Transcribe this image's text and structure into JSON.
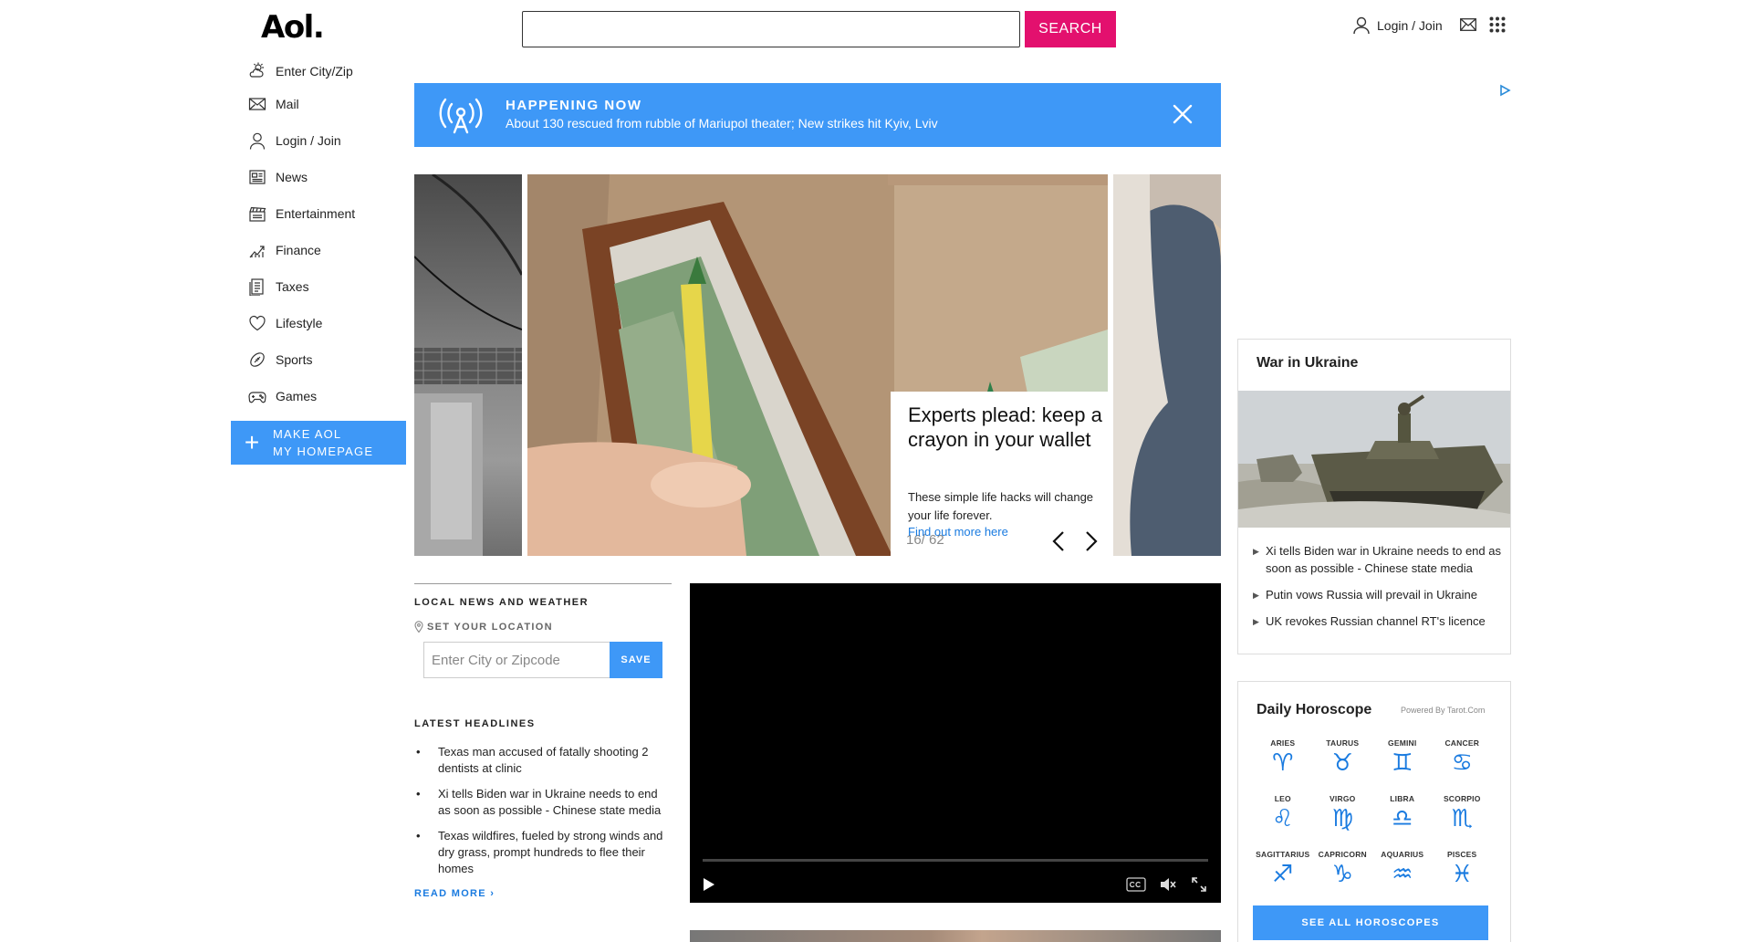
{
  "header": {
    "logo": "Aol.",
    "search_placeholder": "",
    "search_button": "SEARCH",
    "login_label": "Login / Join"
  },
  "nav": {
    "items": [
      {
        "label": "Enter City/Zip",
        "icon": "weather-icon"
      },
      {
        "label": "Mail",
        "icon": "mail-icon"
      },
      {
        "label": "Login / Join",
        "icon": "user-icon"
      },
      {
        "label": "News",
        "icon": "newspaper-icon"
      },
      {
        "label": "Entertainment",
        "icon": "clapperboard-icon"
      },
      {
        "label": "Finance",
        "icon": "chart-icon"
      },
      {
        "label": "Taxes",
        "icon": "document-icon"
      },
      {
        "label": "Lifestyle",
        "icon": "heart-icon"
      },
      {
        "label": "Sports",
        "icon": "football-icon"
      },
      {
        "label": "Games",
        "icon": "gamepad-icon"
      }
    ],
    "make_homepage_line1": "MAKE AOL",
    "make_homepage_line2": "MY HOMEPAGE"
  },
  "breaking": {
    "label": "HAPPENING NOW",
    "text": "About 130 rescued from rubble of Mariupol theater; New strikes hit Kyiv, Lviv"
  },
  "carousel": {
    "title": "Experts plead: keep a crayon in your wallet",
    "description": "These simple life hacks will change your life forever.",
    "link": "Find out more here",
    "counter": "16/ 62"
  },
  "local": {
    "title": "LOCAL NEWS AND WEATHER",
    "set_location": "SET YOUR LOCATION",
    "input_placeholder": "Enter City or Zipcode",
    "save": "SAVE",
    "latest_title": "LATEST HEADLINES",
    "headlines": [
      "Texas man accused of fatally shooting 2 dentists at clinic",
      "Xi tells Biden war in Ukraine needs to end as soon as possible - Chinese state media",
      "Texas wildfires, fueled by strong winds and dry grass, prompt hundreds to flee their homes"
    ],
    "read_more": "READ MORE ›"
  },
  "war": {
    "title": "War in Ukraine",
    "items": [
      "Xi tells Biden war in Ukraine needs to end as soon as possible - Chinese state media",
      "Putin vows Russia will prevail in Ukraine",
      "UK revokes Russian channel RT's licence"
    ]
  },
  "horoscope": {
    "title": "Daily Horoscope",
    "powered": "Powered By Tarot.Com",
    "signs": [
      {
        "name": "ARIES",
        "glyph": "♈"
      },
      {
        "name": "TAURUS",
        "glyph": "♉"
      },
      {
        "name": "GEMINI",
        "glyph": "♊"
      },
      {
        "name": "CANCER",
        "glyph": "♋"
      },
      {
        "name": "LEO",
        "glyph": "♌"
      },
      {
        "name": "VIRGO",
        "glyph": "♍"
      },
      {
        "name": "LIBRA",
        "glyph": "♎"
      },
      {
        "name": "SCORPIO",
        "glyph": "♏"
      },
      {
        "name": "SAGITTARIUS",
        "glyph": "♐"
      },
      {
        "name": "CAPRICORN",
        "glyph": "♑"
      },
      {
        "name": "AQUARIUS",
        "glyph": "♒"
      },
      {
        "name": "PISCES",
        "glyph": "♓"
      }
    ],
    "see_all": "SEE ALL HOROSCOPES"
  },
  "colors": {
    "accent_blue": "#3e98f7",
    "search_pink": "#e3106e",
    "link_blue": "#1a7be0"
  }
}
